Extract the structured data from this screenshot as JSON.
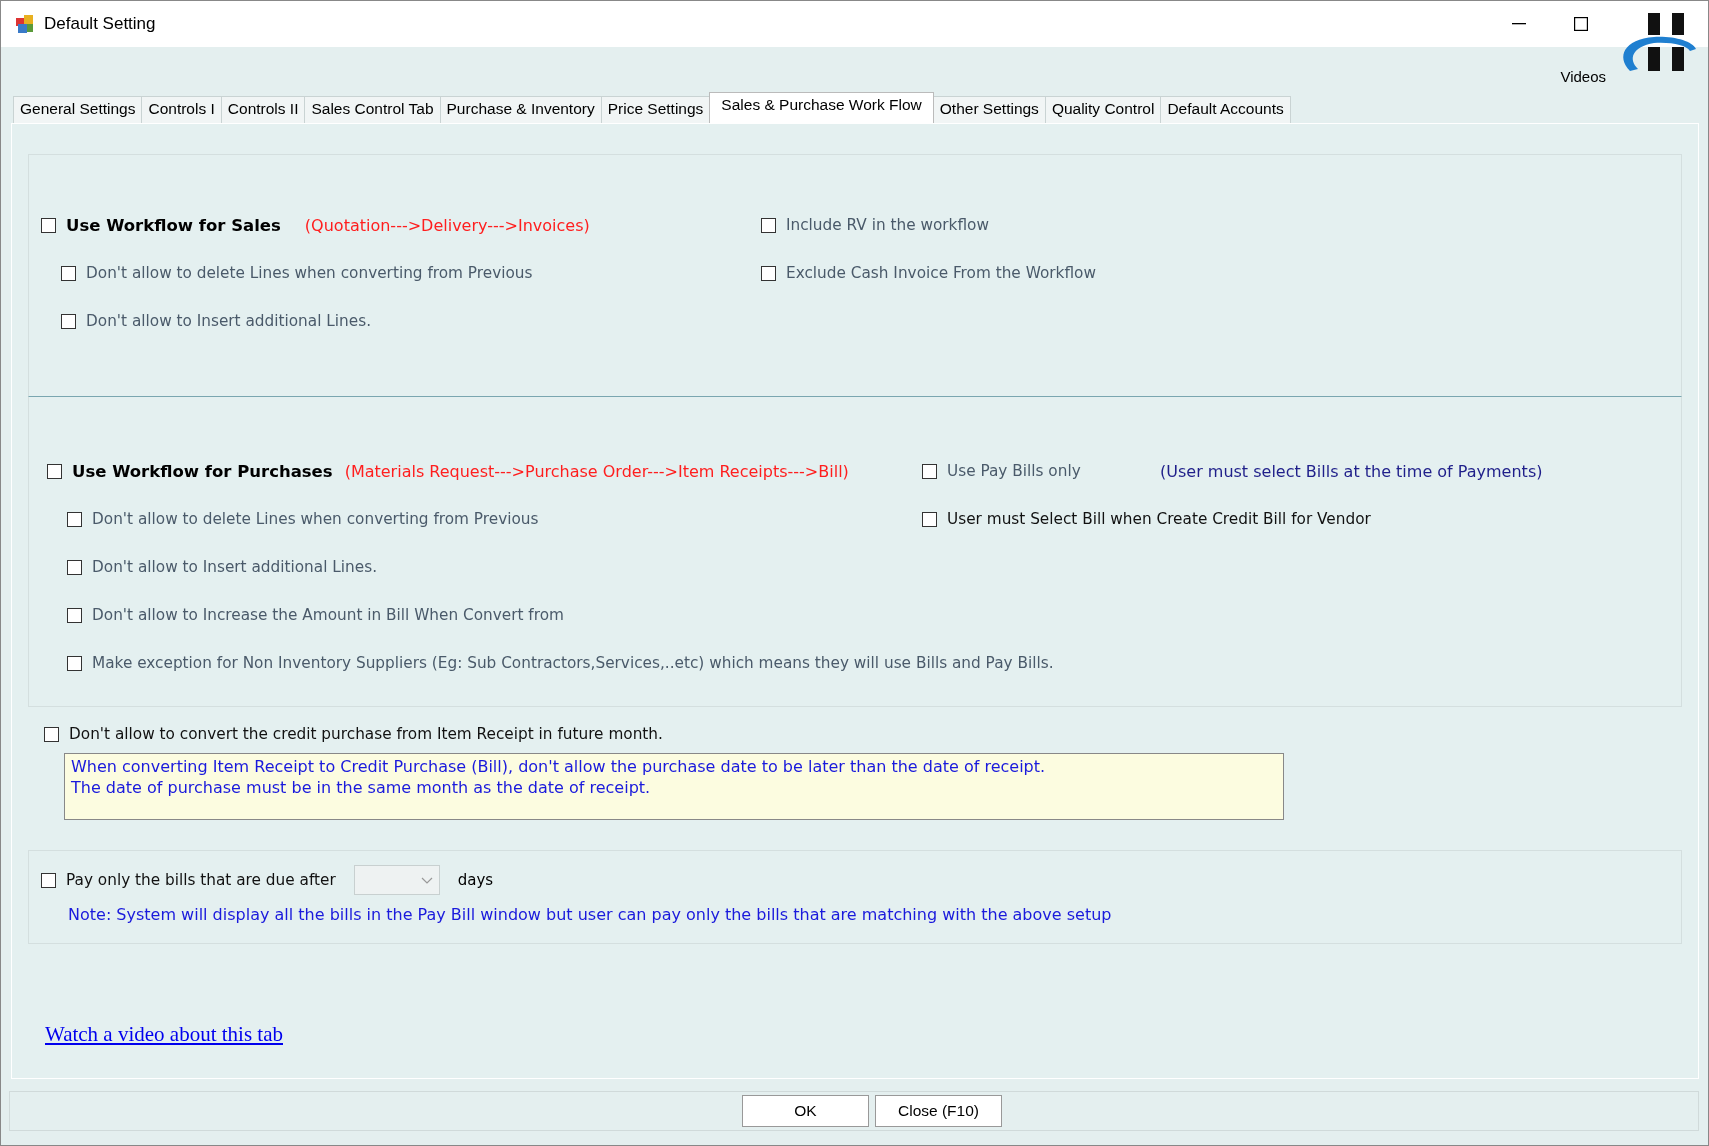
{
  "window": {
    "title": "Default Setting",
    "videos_label": "Videos"
  },
  "tabs": [
    {
      "label": "General Settings",
      "selected": false
    },
    {
      "label": "Controls I",
      "selected": false
    },
    {
      "label": "Controls II",
      "selected": false
    },
    {
      "label": "Sales Control Tab",
      "selected": false
    },
    {
      "label": "Purchase & Inventory",
      "selected": false
    },
    {
      "label": "Price Settings",
      "selected": false
    },
    {
      "label": "Sales & Purchase Work Flow",
      "selected": true
    },
    {
      "label": "Other Settings",
      "selected": false
    },
    {
      "label": "Quality Control",
      "selected": false
    },
    {
      "label": "Default Accounts",
      "selected": false
    }
  ],
  "sales_section": {
    "main": {
      "label": "Use Workflow for Sales",
      "checked": false,
      "flow": "(Quotation--->Delivery--->Invoices)"
    },
    "options": [
      {
        "label": "Don't allow to delete Lines when converting from Previous",
        "checked": false
      },
      {
        "label": "Don't allow to Insert additional Lines.",
        "checked": false
      }
    ],
    "right_options": [
      {
        "label": "Include RV in the workflow",
        "checked": false
      },
      {
        "label": "Exclude Cash Invoice From the Workflow",
        "checked": false
      }
    ]
  },
  "purchase_section": {
    "main": {
      "label": "Use Workflow for Purchases",
      "checked": false,
      "flow": "(Materials Request--->Purchase Order--->Item Receipts--->Bill)"
    },
    "pay_bills_only": {
      "label": "Use Pay Bills only",
      "checked": false,
      "note": "(User must select Bills at the time of Payments)"
    },
    "vendor_option": {
      "label": "User must Select Bill when Create Credit Bill for Vendor",
      "checked": false
    },
    "options": [
      {
        "label": "Don't allow to delete Lines when converting from Previous",
        "checked": false
      },
      {
        "label": "Don't allow to Insert additional Lines.",
        "checked": false
      },
      {
        "label": "Don't allow to Increase the Amount in Bill When Convert from",
        "checked": false
      },
      {
        "label": "Make exception for Non Inventory Suppliers (Eg: Sub Contractors,Services,..etc) which means they will use Bills and Pay Bills.",
        "checked": false
      }
    ]
  },
  "credit_purchase": {
    "label": "Don't allow to convert the credit purchase from Item Receipt in future month.",
    "checked": false,
    "note_lines": [
      "When converting Item Receipt to Credit Purchase (Bill), don't allow the purchase date to be later than the date of receipt.",
      "The date of purchase must be in the same month as the date of receipt."
    ]
  },
  "pay_due": {
    "label": "Pay only the bills that are due after",
    "checked": false,
    "unit": "days",
    "note": "Note: System will display all the bills in the Pay Bill window but user can pay only the bills that are matching with the above setup"
  },
  "video_link": "Watch a video about this tab",
  "buttons": [
    "OK",
    "Close (F10)"
  ]
}
